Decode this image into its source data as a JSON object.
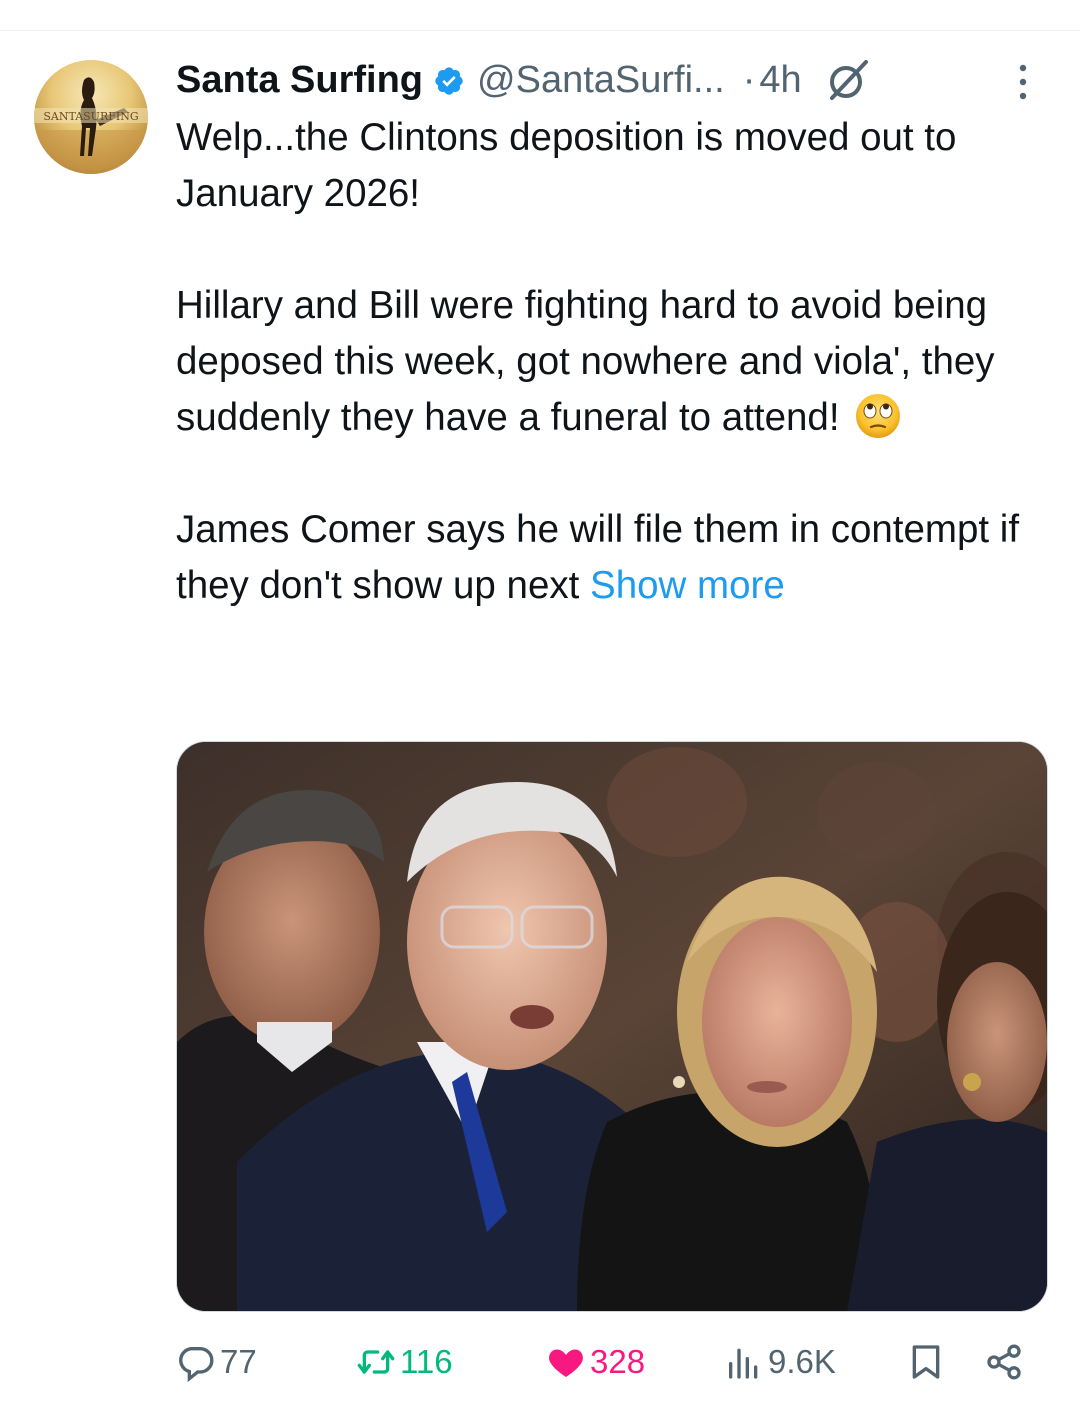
{
  "post": {
    "author": {
      "display_name": "Santa Surfing",
      "handle": "@SantaSurfi...",
      "verified": true,
      "avatar_text": "SANTASURFING"
    },
    "separator": "·",
    "time": "4h",
    "text": {
      "p1": "Welp...the Clintons deposition is moved out to January 2026!",
      "p2": "Hillary and Bill were fighting hard to avoid being deposed this week, got nowhere and viola', they suddenly they have a funeral to attend!",
      "p3": "James Comer says he will file them in contempt if they don't show up next",
      "show_more": "Show more"
    },
    "icons": {
      "verified": "verified-badge-icon",
      "grok": "grok-icon",
      "more": "more-options-icon",
      "emoji": "face-with-rolling-eyes-emoji"
    }
  },
  "actions": {
    "reply_count": "77",
    "retweet_count": "116",
    "like_count": "328",
    "views_count": "9.6K",
    "liked": true
  },
  "colors": {
    "text": "#0f1419",
    "secondary": "#536471",
    "link": "#1d9bf0",
    "verified": "#1d9bf0",
    "retweet": "#00ba7c",
    "like": "#f91880"
  }
}
